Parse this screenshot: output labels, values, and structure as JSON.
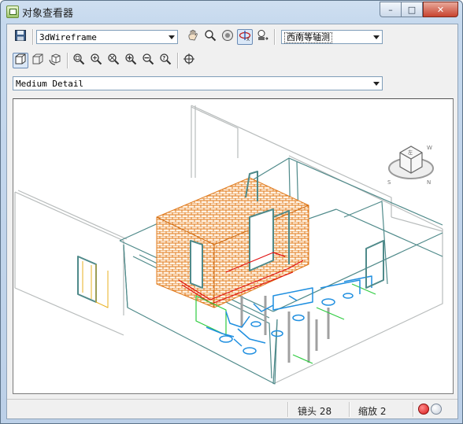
{
  "window": {
    "title": "对象查看器"
  },
  "caption": {
    "minimize": "–",
    "maximize": "□",
    "close": "✕"
  },
  "toolbar1": {
    "visual_style": "3dWireframe",
    "view": "西南等轴测"
  },
  "toolbar2": {
    "detail": "Medium Detail"
  },
  "viewcube": {
    "face": "左",
    "south": "S",
    "north": "N",
    "west": "W"
  },
  "status": {
    "lens": "镜头 28",
    "zoom": "缩放 2"
  },
  "colors": {
    "brick": "#e07b1e",
    "pipe_blue": "#1f8fe0",
    "red_pipe": "#e01010",
    "wall": "#4f8a8a",
    "green": "#2ecc40"
  }
}
